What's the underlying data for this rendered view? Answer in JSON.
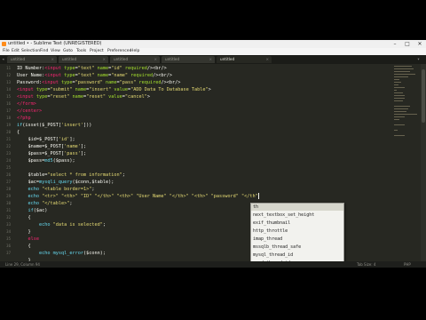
{
  "window": {
    "title": "untitled • - Sublime Text (UNREGISTERED)",
    "minimize": "–",
    "maximize": "□",
    "close": "✕"
  },
  "menu": [
    "File",
    "Edit",
    "Selection",
    "Find",
    "View",
    "Goto",
    "Tools",
    "Project",
    "Preferences",
    "Help"
  ],
  "tabs": [
    {
      "label": "untitled",
      "active": false
    },
    {
      "label": "untitled",
      "active": false
    },
    {
      "label": "untitled",
      "active": false
    },
    {
      "label": "untitled",
      "active": false
    },
    {
      "label": "untitled",
      "active": true
    }
  ],
  "editor": {
    "line_numbers": [
      "11",
      "12",
      "13",
      "14",
      "15",
      "16",
      "17",
      "18",
      "19",
      "20",
      "21",
      "22",
      "23",
      "24",
      "25",
      "26",
      "27",
      "28",
      "29",
      "30",
      "31",
      "32",
      "33",
      "34",
      "35",
      "36",
      "37"
    ],
    "lines": [
      [
        [
          "v",
          "ID Number:"
        ],
        [
          "k",
          "<input "
        ],
        [
          "a",
          "type"
        ],
        [
          "v",
          "="
        ],
        [
          "s",
          "\"text\""
        ],
        [
          "a",
          " name"
        ],
        [
          "v",
          "="
        ],
        [
          "s",
          "\"id\""
        ],
        [
          "a",
          " required"
        ],
        [
          "v",
          "/><br/>"
        ]
      ],
      [
        [
          "v",
          "User Name:"
        ],
        [
          "k",
          "<input "
        ],
        [
          "a",
          "type"
        ],
        [
          "v",
          "="
        ],
        [
          "s",
          "\"text\""
        ],
        [
          "a",
          " name"
        ],
        [
          "v",
          "="
        ],
        [
          "s",
          "\"name\""
        ],
        [
          "a",
          " required"
        ],
        [
          "v",
          "/><br/>"
        ]
      ],
      [
        [
          "v",
          "Password:"
        ],
        [
          "k",
          "<input "
        ],
        [
          "a",
          "type"
        ],
        [
          "v",
          "="
        ],
        [
          "s",
          "\"password\""
        ],
        [
          "a",
          " name"
        ],
        [
          "v",
          "="
        ],
        [
          "s",
          "\"pass\""
        ],
        [
          "a",
          " required"
        ],
        [
          "v",
          "/><br/>"
        ]
      ],
      [
        [
          "k",
          "<input "
        ],
        [
          "a",
          "type"
        ],
        [
          "v",
          "="
        ],
        [
          "s",
          "\"submit\""
        ],
        [
          "a",
          " name"
        ],
        [
          "v",
          "="
        ],
        [
          "s",
          "\"insert\""
        ],
        [
          "a",
          " value"
        ],
        [
          "v",
          "="
        ],
        [
          "s",
          "\"ADD Data To Database Table\""
        ],
        [
          "v",
          ">"
        ]
      ],
      [
        [
          "k",
          "<input "
        ],
        [
          "a",
          "type"
        ],
        [
          "v",
          "="
        ],
        [
          "s",
          "\"reset\""
        ],
        [
          "a",
          " name"
        ],
        [
          "v",
          "="
        ],
        [
          "s",
          "\"reset\""
        ],
        [
          "a",
          " value"
        ],
        [
          "v",
          "="
        ],
        [
          "s",
          "\"cancel\""
        ],
        [
          "v",
          ">"
        ]
      ],
      [
        [
          "k",
          "</form>"
        ]
      ],
      [
        [
          "k",
          "</center>"
        ]
      ],
      [
        [
          "k",
          "<?php"
        ]
      ],
      [
        [
          "f",
          "if"
        ],
        [
          "v",
          "(isset($_POST["
        ],
        [
          "s",
          "'insert'"
        ],
        [
          "v",
          "]))"
        ]
      ],
      [
        [
          "v",
          "{"
        ]
      ],
      [
        [
          "v",
          "    $id=$_POST["
        ],
        [
          "s",
          "'id'"
        ],
        [
          "v",
          "];"
        ]
      ],
      [
        [
          "v",
          "    $name=$_POST["
        ],
        [
          "s",
          "'name'"
        ],
        [
          "v",
          "];"
        ]
      ],
      [
        [
          "v",
          "    $pass=$_POST["
        ],
        [
          "s",
          "'pass'"
        ],
        [
          "v",
          "];"
        ]
      ],
      [
        [
          "v",
          "    $pass="
        ],
        [
          "f",
          "md5"
        ],
        [
          "v",
          "($pass);"
        ]
      ],
      [
        [
          "v",
          ""
        ]
      ],
      [
        [
          "v",
          "    $table="
        ],
        [
          "s",
          "\"select * from information\""
        ],
        [
          "v",
          ";"
        ]
      ],
      [
        [
          "v",
          "    $ac="
        ],
        [
          "f",
          "mysqli_query"
        ],
        [
          "v",
          "($conn,$table);"
        ]
      ],
      [
        [
          "f",
          "    echo "
        ],
        [
          "s",
          "\"<table border=1>\""
        ],
        [
          "v",
          ";"
        ]
      ],
      [
        [
          "f",
          "    echo "
        ],
        [
          "s",
          "\"<tr>\" \"<th>\" \"ID\" \"</th>\" \"<th>\" \"User Name\" \"</th>\" \"<th>\" \"password\" \"</th\""
        ]
      ],
      [
        [
          "f",
          "    echo "
        ],
        [
          "s",
          "\"</table>\""
        ],
        [
          "v",
          ";"
        ]
      ],
      [
        [
          "f",
          "    if"
        ],
        [
          "v",
          "($ac)"
        ]
      ],
      [
        [
          "v",
          "    {"
        ]
      ],
      [
        [
          "f",
          "        echo "
        ],
        [
          "s",
          "\"data is selected\""
        ],
        [
          "v",
          ";"
        ]
      ],
      [
        [
          "v",
          "    }"
        ]
      ],
      [
        [
          "k",
          "    else"
        ]
      ],
      [
        [
          "v",
          "    {"
        ]
      ],
      [
        [
          "f",
          "        echo "
        ],
        [
          "f",
          "mysql_error"
        ],
        [
          "v",
          "($conn);"
        ]
      ],
      [
        [
          "v",
          "    }"
        ]
      ],
      [
        [
          "v",
          "}"
        ]
      ]
    ]
  },
  "autocomplete": {
    "items": [
      "th",
      "next_textbox_set_height",
      "exif_thumbnail",
      "http_throttle",
      "imap_thread",
      "mssqlb_thread_safe",
      "mysql_thread_id",
      "zend_thread_id"
    ],
    "selected_index": 0
  },
  "statusbar": {
    "left": "Line 29, Column 94",
    "tab_size": "Tab Size: 4",
    "syntax": "PHP"
  }
}
